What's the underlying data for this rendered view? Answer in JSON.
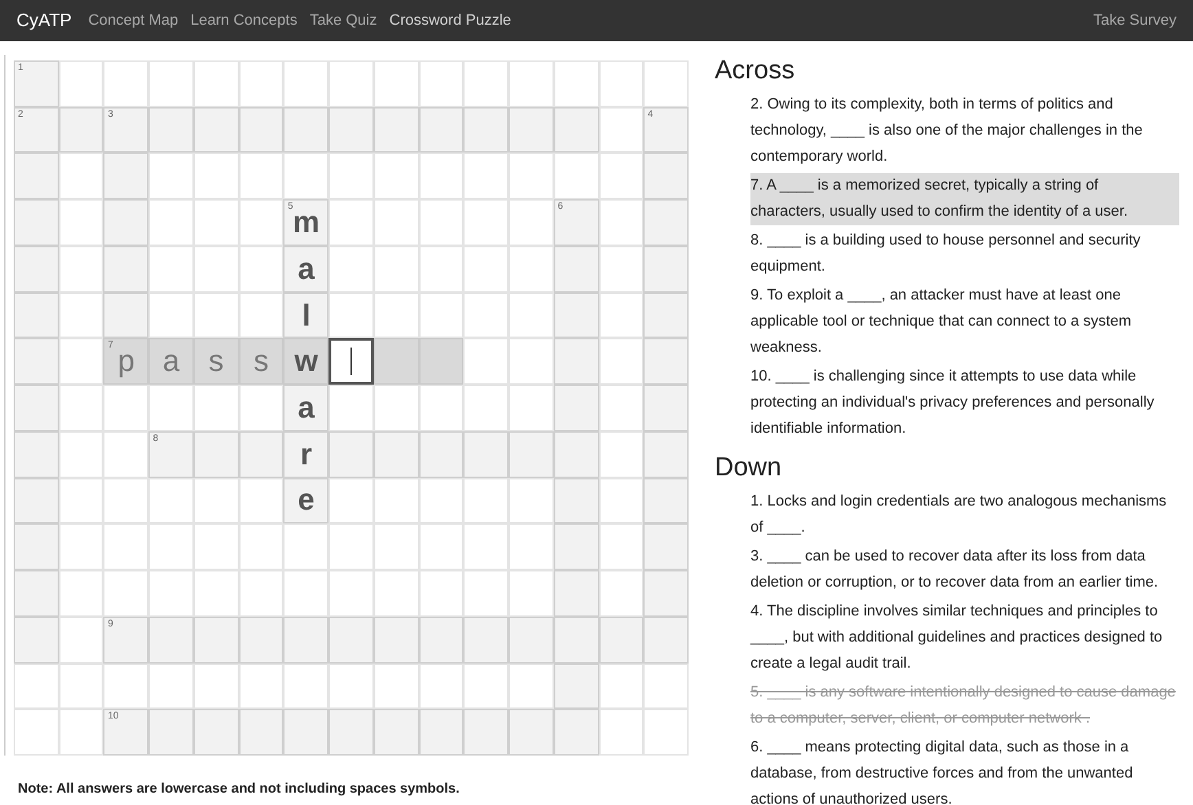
{
  "navbar": {
    "brand": "CyATP",
    "links": [
      {
        "label": "Concept Map",
        "selected": false
      },
      {
        "label": "Learn Concepts",
        "selected": false
      },
      {
        "label": "Take Quiz",
        "selected": false
      },
      {
        "label": "Crossword Puzzle",
        "selected": true
      }
    ],
    "right_link": "Take Survey"
  },
  "grid": [
    [
      {
        "kind": "cell",
        "number": "1",
        "highlighted": false,
        "focused": false
      },
      {
        "kind": "void"
      },
      {
        "kind": "void"
      },
      {
        "kind": "void"
      },
      {
        "kind": "void"
      },
      {
        "kind": "void"
      },
      {
        "kind": "void"
      },
      {
        "kind": "void"
      },
      {
        "kind": "void"
      },
      {
        "kind": "void"
      },
      {
        "kind": "void"
      },
      {
        "kind": "void"
      },
      {
        "kind": "void"
      },
      {
        "kind": "void"
      },
      {
        "kind": "void"
      }
    ],
    [
      {
        "kind": "cell",
        "number": "2",
        "highlighted": false,
        "focused": false
      },
      {
        "kind": "cell",
        "highlighted": false,
        "focused": false
      },
      {
        "kind": "cell",
        "number": "3",
        "highlighted": false,
        "focused": false
      },
      {
        "kind": "cell",
        "highlighted": false,
        "focused": false
      },
      {
        "kind": "cell",
        "highlighted": false,
        "focused": false
      },
      {
        "kind": "cell",
        "highlighted": false,
        "focused": false
      },
      {
        "kind": "cell",
        "highlighted": false,
        "focused": false
      },
      {
        "kind": "cell",
        "highlighted": false,
        "focused": false
      },
      {
        "kind": "cell",
        "highlighted": false,
        "focused": false
      },
      {
        "kind": "cell",
        "highlighted": false,
        "focused": false
      },
      {
        "kind": "cell",
        "highlighted": false,
        "focused": false
      },
      {
        "kind": "cell",
        "highlighted": false,
        "focused": false
      },
      {
        "kind": "cell",
        "highlighted": false,
        "focused": false
      },
      {
        "kind": "void"
      },
      {
        "kind": "cell",
        "number": "4",
        "highlighted": false,
        "focused": false
      }
    ],
    [
      {
        "kind": "cell",
        "highlighted": false,
        "focused": false
      },
      {
        "kind": "void"
      },
      {
        "kind": "cell",
        "highlighted": false,
        "focused": false
      },
      {
        "kind": "void"
      },
      {
        "kind": "void"
      },
      {
        "kind": "void"
      },
      {
        "kind": "void"
      },
      {
        "kind": "void"
      },
      {
        "kind": "void"
      },
      {
        "kind": "void"
      },
      {
        "kind": "void"
      },
      {
        "kind": "void"
      },
      {
        "kind": "void"
      },
      {
        "kind": "void"
      },
      {
        "kind": "cell",
        "highlighted": false,
        "focused": false
      }
    ],
    [
      {
        "kind": "cell",
        "highlighted": false,
        "focused": false
      },
      {
        "kind": "void"
      },
      {
        "kind": "cell",
        "highlighted": false,
        "focused": false
      },
      {
        "kind": "void"
      },
      {
        "kind": "void"
      },
      {
        "kind": "void"
      },
      {
        "kind": "solved",
        "number": "5",
        "letter": "m",
        "highlighted": false,
        "focused": false
      },
      {
        "kind": "void"
      },
      {
        "kind": "void"
      },
      {
        "kind": "void"
      },
      {
        "kind": "void"
      },
      {
        "kind": "void"
      },
      {
        "kind": "cell",
        "number": "6",
        "highlighted": false,
        "focused": false
      },
      {
        "kind": "void"
      },
      {
        "kind": "cell",
        "highlighted": false,
        "focused": false
      }
    ],
    [
      {
        "kind": "cell",
        "highlighted": false,
        "focused": false
      },
      {
        "kind": "void"
      },
      {
        "kind": "cell",
        "highlighted": false,
        "focused": false
      },
      {
        "kind": "void"
      },
      {
        "kind": "void"
      },
      {
        "kind": "void"
      },
      {
        "kind": "solved",
        "letter": "a",
        "highlighted": false,
        "focused": false
      },
      {
        "kind": "void"
      },
      {
        "kind": "void"
      },
      {
        "kind": "void"
      },
      {
        "kind": "void"
      },
      {
        "kind": "void"
      },
      {
        "kind": "cell",
        "highlighted": false,
        "focused": false
      },
      {
        "kind": "void"
      },
      {
        "kind": "cell",
        "highlighted": false,
        "focused": false
      }
    ],
    [
      {
        "kind": "cell",
        "highlighted": false,
        "focused": false
      },
      {
        "kind": "void"
      },
      {
        "kind": "cell",
        "highlighted": false,
        "focused": false
      },
      {
        "kind": "void"
      },
      {
        "kind": "void"
      },
      {
        "kind": "void"
      },
      {
        "kind": "solved",
        "letter": "l",
        "highlighted": false,
        "focused": false
      },
      {
        "kind": "void"
      },
      {
        "kind": "void"
      },
      {
        "kind": "void"
      },
      {
        "kind": "void"
      },
      {
        "kind": "void"
      },
      {
        "kind": "cell",
        "highlighted": false,
        "focused": false
      },
      {
        "kind": "void"
      },
      {
        "kind": "cell",
        "highlighted": false,
        "focused": false
      }
    ],
    [
      {
        "kind": "cell",
        "highlighted": false,
        "focused": false
      },
      {
        "kind": "void"
      },
      {
        "kind": "cell",
        "number": "7",
        "letter": "p",
        "highlighted": true,
        "focused": false
      },
      {
        "kind": "cell",
        "letter": "a",
        "highlighted": true,
        "focused": false
      },
      {
        "kind": "cell",
        "letter": "s",
        "highlighted": true,
        "focused": false
      },
      {
        "kind": "cell",
        "letter": "s",
        "highlighted": true,
        "focused": false
      },
      {
        "kind": "solved",
        "letter": "w",
        "highlighted": true,
        "focused": false
      },
      {
        "kind": "cell",
        "highlighted": true,
        "focused": true
      },
      {
        "kind": "cell",
        "highlighted": true,
        "focused": false
      },
      {
        "kind": "cell",
        "highlighted": true,
        "focused": false
      },
      {
        "kind": "void"
      },
      {
        "kind": "void"
      },
      {
        "kind": "cell",
        "highlighted": false,
        "focused": false
      },
      {
        "kind": "void"
      },
      {
        "kind": "cell",
        "highlighted": false,
        "focused": false
      }
    ],
    [
      {
        "kind": "cell",
        "highlighted": false,
        "focused": false
      },
      {
        "kind": "void"
      },
      {
        "kind": "void"
      },
      {
        "kind": "void"
      },
      {
        "kind": "void"
      },
      {
        "kind": "void"
      },
      {
        "kind": "solved",
        "letter": "a",
        "highlighted": false,
        "focused": false
      },
      {
        "kind": "void"
      },
      {
        "kind": "void"
      },
      {
        "kind": "void"
      },
      {
        "kind": "void"
      },
      {
        "kind": "void"
      },
      {
        "kind": "cell",
        "highlighted": false,
        "focused": false
      },
      {
        "kind": "void"
      },
      {
        "kind": "cell",
        "highlighted": false,
        "focused": false
      }
    ],
    [
      {
        "kind": "cell",
        "highlighted": false,
        "focused": false
      },
      {
        "kind": "void"
      },
      {
        "kind": "void"
      },
      {
        "kind": "cell",
        "number": "8",
        "highlighted": false,
        "focused": false
      },
      {
        "kind": "cell",
        "highlighted": false,
        "focused": false
      },
      {
        "kind": "cell",
        "highlighted": false,
        "focused": false
      },
      {
        "kind": "solved",
        "letter": "r",
        "highlighted": false,
        "focused": false
      },
      {
        "kind": "cell",
        "highlighted": false,
        "focused": false
      },
      {
        "kind": "cell",
        "highlighted": false,
        "focused": false
      },
      {
        "kind": "cell",
        "highlighted": false,
        "focused": false
      },
      {
        "kind": "cell",
        "highlighted": false,
        "focused": false
      },
      {
        "kind": "cell",
        "highlighted": false,
        "focused": false
      },
      {
        "kind": "cell",
        "highlighted": false,
        "focused": false
      },
      {
        "kind": "void"
      },
      {
        "kind": "cell",
        "highlighted": false,
        "focused": false
      }
    ],
    [
      {
        "kind": "cell",
        "highlighted": false,
        "focused": false
      },
      {
        "kind": "void"
      },
      {
        "kind": "void"
      },
      {
        "kind": "void"
      },
      {
        "kind": "void"
      },
      {
        "kind": "void"
      },
      {
        "kind": "solved",
        "letter": "e",
        "highlighted": false,
        "focused": false
      },
      {
        "kind": "void"
      },
      {
        "kind": "void"
      },
      {
        "kind": "void"
      },
      {
        "kind": "void"
      },
      {
        "kind": "void"
      },
      {
        "kind": "cell",
        "highlighted": false,
        "focused": false
      },
      {
        "kind": "void"
      },
      {
        "kind": "cell",
        "highlighted": false,
        "focused": false
      }
    ],
    [
      {
        "kind": "cell",
        "highlighted": false,
        "focused": false
      },
      {
        "kind": "void"
      },
      {
        "kind": "void"
      },
      {
        "kind": "void"
      },
      {
        "kind": "void"
      },
      {
        "kind": "void"
      },
      {
        "kind": "void"
      },
      {
        "kind": "void"
      },
      {
        "kind": "void"
      },
      {
        "kind": "void"
      },
      {
        "kind": "void"
      },
      {
        "kind": "void"
      },
      {
        "kind": "cell",
        "highlighted": false,
        "focused": false
      },
      {
        "kind": "void"
      },
      {
        "kind": "cell",
        "highlighted": false,
        "focused": false
      }
    ],
    [
      {
        "kind": "cell",
        "highlighted": false,
        "focused": false
      },
      {
        "kind": "void"
      },
      {
        "kind": "void"
      },
      {
        "kind": "void"
      },
      {
        "kind": "void"
      },
      {
        "kind": "void"
      },
      {
        "kind": "void"
      },
      {
        "kind": "void"
      },
      {
        "kind": "void"
      },
      {
        "kind": "void"
      },
      {
        "kind": "void"
      },
      {
        "kind": "void"
      },
      {
        "kind": "cell",
        "highlighted": false,
        "focused": false
      },
      {
        "kind": "void"
      },
      {
        "kind": "cell",
        "highlighted": false,
        "focused": false
      }
    ],
    [
      {
        "kind": "cell",
        "highlighted": false,
        "focused": false
      },
      {
        "kind": "void"
      },
      {
        "kind": "cell",
        "number": "9",
        "highlighted": false,
        "focused": false
      },
      {
        "kind": "cell",
        "highlighted": false,
        "focused": false
      },
      {
        "kind": "cell",
        "highlighted": false,
        "focused": false
      },
      {
        "kind": "cell",
        "highlighted": false,
        "focused": false
      },
      {
        "kind": "cell",
        "highlighted": false,
        "focused": false
      },
      {
        "kind": "cell",
        "highlighted": false,
        "focused": false
      },
      {
        "kind": "cell",
        "highlighted": false,
        "focused": false
      },
      {
        "kind": "cell",
        "highlighted": false,
        "focused": false
      },
      {
        "kind": "cell",
        "highlighted": false,
        "focused": false
      },
      {
        "kind": "cell",
        "highlighted": false,
        "focused": false
      },
      {
        "kind": "cell",
        "highlighted": false,
        "focused": false
      },
      {
        "kind": "cell",
        "highlighted": false,
        "focused": false
      },
      {
        "kind": "cell",
        "highlighted": false,
        "focused": false
      }
    ],
    [
      {
        "kind": "void"
      },
      {
        "kind": "void"
      },
      {
        "kind": "void"
      },
      {
        "kind": "void"
      },
      {
        "kind": "void"
      },
      {
        "kind": "void"
      },
      {
        "kind": "void"
      },
      {
        "kind": "void"
      },
      {
        "kind": "void"
      },
      {
        "kind": "void"
      },
      {
        "kind": "void"
      },
      {
        "kind": "void"
      },
      {
        "kind": "cell",
        "highlighted": false,
        "focused": false
      },
      {
        "kind": "void"
      },
      {
        "kind": "void"
      }
    ],
    [
      {
        "kind": "void"
      },
      {
        "kind": "void"
      },
      {
        "kind": "cell",
        "number": "10",
        "highlighted": false,
        "focused": false
      },
      {
        "kind": "cell",
        "highlighted": false,
        "focused": false
      },
      {
        "kind": "cell",
        "highlighted": false,
        "focused": false
      },
      {
        "kind": "cell",
        "highlighted": false,
        "focused": false
      },
      {
        "kind": "cell",
        "highlighted": false,
        "focused": false
      },
      {
        "kind": "cell",
        "highlighted": false,
        "focused": false
      },
      {
        "kind": "cell",
        "highlighted": false,
        "focused": false
      },
      {
        "kind": "cell",
        "highlighted": false,
        "focused": false
      },
      {
        "kind": "cell",
        "highlighted": false,
        "focused": false
      },
      {
        "kind": "cell",
        "highlighted": false,
        "focused": false
      },
      {
        "kind": "cell",
        "highlighted": false,
        "focused": false
      },
      {
        "kind": "void"
      },
      {
        "kind": "void"
      }
    ]
  ],
  "clues": [
    {
      "heading": "Across",
      "items": [
        {
          "text": "2. Owing to its complexity, both in terms of politics and technology, ____ is also one of the major challenges in the contemporary world.",
          "selected": false,
          "solved": false
        },
        {
          "text": "7. A ____ is a memorized secret, typically a string of characters, usually used to confirm the identity of a user.",
          "selected": true,
          "solved": false
        },
        {
          "text": "8. ____ is a building used to house personnel and security equipment.",
          "selected": false,
          "solved": false
        },
        {
          "text": "9. To exploit a ____, an attacker must have at least one applicable tool or technique that can connect to a system weakness.",
          "selected": false,
          "solved": false
        },
        {
          "text": "10. ____ is challenging since it attempts to use data while protecting an individual's privacy preferences and personally identifiable information.",
          "selected": false,
          "solved": false
        }
      ]
    },
    {
      "heading": "Down",
      "items": [
        {
          "text": "1. Locks and login credentials are two analogous mechanisms of ____.",
          "selected": false,
          "solved": false
        },
        {
          "text": "3. ____ can be used to recover data after its loss from data deletion or corruption, or to recover data from an earlier time.",
          "selected": false,
          "solved": false
        },
        {
          "text": "4. The discipline involves similar techniques and principles to ____, but with additional guidelines and practices designed to create a legal audit trail.",
          "selected": false,
          "solved": false
        },
        {
          "text": "5. ____ is any software intentionally designed to cause damage to a computer, server, client, or computer network .",
          "selected": false,
          "solved": true
        },
        {
          "text": "6. ____ means protecting digital data, such as those in a database, from destructive forces and from the unwanted actions of unauthorized users.",
          "selected": false,
          "solved": false
        }
      ]
    }
  ],
  "note": "Note: All answers are lowercase and not including spaces symbols."
}
